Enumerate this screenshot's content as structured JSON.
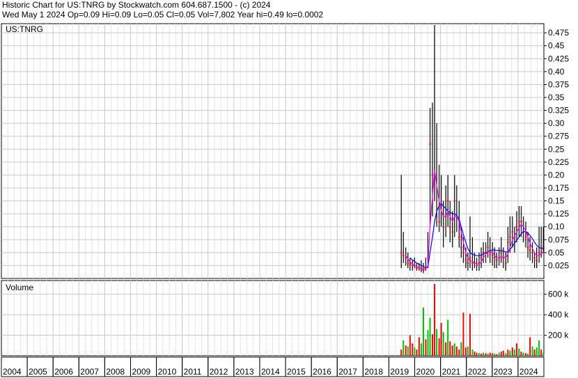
{
  "header": {
    "line1": "Historic Chart for US:TNRG by Stockwatch.com 604.687.1500 - (c) 2024",
    "line2": "Wed May  1 2024  Op=0.09  Hi=0.09  Lo=0.05  Cl=0.05  Vol=7,802  Year hi=0.49  lo=0.0002"
  },
  "colors": {
    "price_bar": "#000000",
    "ma_short": "#ff00ff",
    "ma_long": "#0000ff",
    "close_dot": "#ff0000",
    "volume_up": "#00c000",
    "volume_down": "#ff0000",
    "grid": "#c8c8c8",
    "axis": "#000000"
  },
  "chart_data": [
    {
      "type": "line",
      "panel": "price",
      "label": "US:TNRG",
      "ylim": [
        0,
        0.49
      ],
      "y_ticks": [
        "0.025",
        "0.05",
        "0.075",
        "0.10",
        "0.125",
        "0.15",
        "0.175",
        "0.20",
        "0.225",
        "0.25",
        "0.275",
        "0.30",
        "0.325",
        "0.35",
        "0.375",
        "0.40",
        "0.425",
        "0.45",
        "0.475"
      ],
      "x_ticks": [
        "2004",
        "2005",
        "2006",
        "2007",
        "2008",
        "2009",
        "2010",
        "2011",
        "2012",
        "2013",
        "2014",
        "2015",
        "2016",
        "2017",
        "2018",
        "2019",
        "2020",
        "2021",
        "2022",
        "2023",
        "2024"
      ],
      "xlim": [
        2004.0,
        2024.35
      ],
      "grid": true,
      "series": [
        {
          "x": [
            2019.0,
            2019.08,
            2019.17,
            2019.25,
            2019.33,
            2019.42,
            2019.5,
            2019.58,
            2019.67,
            2019.75,
            2019.83,
            2019.92,
            2020.0,
            2020.08,
            2020.17,
            2020.25,
            2020.33,
            2020.42,
            2020.5,
            2020.58,
            2020.67,
            2020.75,
            2020.83,
            2020.92,
            2021.0,
            2021.08,
            2021.17,
            2021.25,
            2021.33,
            2021.42,
            2021.5,
            2021.58,
            2021.67,
            2021.75,
            2021.83,
            2021.92,
            2022.0,
            2022.08,
            2022.17,
            2022.25,
            2022.33,
            2022.42,
            2022.5,
            2022.58,
            2022.67,
            2022.75,
            2022.83,
            2022.92,
            2023.0,
            2023.08,
            2023.17,
            2023.25,
            2023.33,
            2023.42,
            2023.5,
            2023.58,
            2023.67,
            2023.75,
            2023.83,
            2023.92,
            2024.0,
            2024.08,
            2024.17,
            2024.25,
            2024.33
          ],
          "high": [
            0.2,
            0.09,
            0.06,
            0.05,
            0.04,
            0.035,
            0.04,
            0.03,
            0.03,
            0.035,
            0.03,
            0.04,
            0.09,
            0.33,
            0.34,
            0.49,
            0.3,
            0.22,
            0.2,
            0.15,
            0.18,
            0.2,
            0.15,
            0.13,
            0.2,
            0.18,
            0.15,
            0.1,
            0.08,
            0.06,
            0.05,
            0.12,
            0.08,
            0.05,
            0.04,
            0.05,
            0.06,
            0.07,
            0.07,
            0.09,
            0.08,
            0.07,
            0.06,
            0.05,
            0.06,
            0.08,
            0.06,
            0.05,
            0.1,
            0.12,
            0.12,
            0.1,
            0.13,
            0.14,
            0.14,
            0.12,
            0.11,
            0.09,
            0.08,
            0.07,
            0.05,
            0.06,
            0.1,
            0.1,
            0.1
          ],
          "low": [
            0.02,
            0.03,
            0.025,
            0.02,
            0.015,
            0.015,
            0.02,
            0.015,
            0.015,
            0.012,
            0.01,
            0.015,
            0.02,
            0.1,
            0.12,
            0.15,
            0.1,
            0.09,
            0.1,
            0.06,
            0.08,
            0.1,
            0.07,
            0.06,
            0.08,
            0.09,
            0.06,
            0.04,
            0.03,
            0.02,
            0.015,
            0.02,
            0.015,
            0.02,
            0.015,
            0.015,
            0.02,
            0.03,
            0.03,
            0.04,
            0.03,
            0.025,
            0.02,
            0.02,
            0.025,
            0.03,
            0.02,
            0.015,
            0.03,
            0.05,
            0.06,
            0.05,
            0.07,
            0.08,
            0.08,
            0.07,
            0.06,
            0.04,
            0.035,
            0.03,
            0.02,
            0.02,
            0.03,
            0.04,
            0.05
          ],
          "close": [
            0.05,
            0.045,
            0.04,
            0.03,
            0.028,
            0.025,
            0.025,
            0.02,
            0.02,
            0.018,
            0.016,
            0.02,
            0.04,
            0.26,
            0.2,
            0.18,
            0.12,
            0.11,
            0.14,
            0.1,
            0.12,
            0.15,
            0.1,
            0.09,
            0.15,
            0.12,
            0.08,
            0.06,
            0.05,
            0.035,
            0.03,
            0.04,
            0.03,
            0.03,
            0.025,
            0.03,
            0.04,
            0.05,
            0.05,
            0.06,
            0.05,
            0.045,
            0.04,
            0.035,
            0.04,
            0.05,
            0.04,
            0.03,
            0.07,
            0.08,
            0.09,
            0.08,
            0.1,
            0.11,
            0.11,
            0.09,
            0.08,
            0.06,
            0.055,
            0.05,
            0.04,
            0.035,
            0.05,
            0.06,
            0.05
          ],
          "ma_short": [
            null,
            null,
            0.045,
            0.038,
            0.032,
            0.028,
            0.026,
            0.023,
            0.021,
            0.02,
            0.018,
            0.018,
            0.025,
            0.1,
            0.16,
            0.21,
            0.18,
            0.15,
            0.13,
            0.12,
            0.12,
            0.13,
            0.12,
            0.11,
            0.12,
            0.12,
            0.11,
            0.09,
            0.07,
            0.05,
            0.04,
            0.035,
            0.033,
            0.031,
            0.028,
            0.028,
            0.032,
            0.04,
            0.046,
            0.052,
            0.052,
            0.05,
            0.045,
            0.04,
            0.04,
            0.042,
            0.042,
            0.04,
            0.047,
            0.06,
            0.075,
            0.082,
            0.09,
            0.098,
            0.105,
            0.1,
            0.092,
            0.08,
            0.068,
            0.058,
            0.05,
            0.044,
            0.044,
            0.048,
            0.052
          ],
          "ma_long": [
            null,
            null,
            null,
            null,
            0.04,
            0.036,
            0.033,
            0.03,
            0.027,
            0.025,
            0.023,
            0.021,
            0.022,
            0.05,
            0.08,
            0.11,
            0.13,
            0.14,
            0.145,
            0.14,
            0.135,
            0.13,
            0.128,
            0.125,
            0.125,
            0.122,
            0.115,
            0.1,
            0.085,
            0.07,
            0.058,
            0.05,
            0.047,
            0.045,
            0.044,
            0.044,
            0.045,
            0.047,
            0.05,
            0.052,
            0.054,
            0.055,
            0.055,
            0.054,
            0.054,
            0.054,
            0.053,
            0.051,
            0.052,
            0.056,
            0.062,
            0.068,
            0.074,
            0.08,
            0.087,
            0.09,
            0.091,
            0.088,
            0.083,
            0.077,
            0.07,
            0.064,
            0.06,
            0.058,
            0.058
          ]
        }
      ]
    },
    {
      "type": "bar",
      "panel": "volume",
      "label": "Volume",
      "ylim": [
        0,
        720000
      ],
      "y_ticks": [
        "200 k",
        "400 k",
        "600 k"
      ],
      "x": [
        2019.0,
        2019.08,
        2019.17,
        2019.25,
        2019.33,
        2019.42,
        2019.5,
        2019.58,
        2019.67,
        2019.75,
        2019.83,
        2019.92,
        2020.0,
        2020.08,
        2020.17,
        2020.25,
        2020.33,
        2020.42,
        2020.5,
        2020.58,
        2020.67,
        2020.75,
        2020.83,
        2020.92,
        2021.0,
        2021.08,
        2021.17,
        2021.25,
        2021.33,
        2021.42,
        2021.5,
        2021.58,
        2021.67,
        2021.75,
        2021.83,
        2021.92,
        2022.0,
        2022.08,
        2022.17,
        2022.25,
        2022.33,
        2022.42,
        2022.5,
        2022.58,
        2022.67,
        2022.75,
        2022.83,
        2022.92,
        2023.0,
        2023.08,
        2023.17,
        2023.25,
        2023.33,
        2023.42,
        2023.5,
        2023.58,
        2023.67,
        2023.75,
        2023.83,
        2023.92,
        2024.0,
        2024.08,
        2024.17,
        2024.25,
        2024.33
      ],
      "values": [
        60000,
        150000,
        100000,
        90000,
        200000,
        120000,
        80000,
        60000,
        180000,
        120000,
        470000,
        160000,
        250000,
        370000,
        210000,
        700000,
        260000,
        170000,
        320000,
        230000,
        130000,
        350000,
        140000,
        100000,
        120000,
        90000,
        60000,
        130000,
        420000,
        80000,
        90000,
        410000,
        60000,
        40000,
        30000,
        25000,
        20000,
        30000,
        25000,
        20000,
        30000,
        25000,
        20000,
        15000,
        30000,
        40000,
        50000,
        25000,
        60000,
        50000,
        80000,
        60000,
        120000,
        70000,
        40000,
        30000,
        25000,
        20000,
        180000,
        90000,
        60000,
        80000,
        150000,
        60000,
        30000
      ],
      "up": [
        false,
        true,
        false,
        true,
        false,
        false,
        true,
        false,
        false,
        true,
        true,
        false,
        true,
        true,
        false,
        false,
        true,
        false,
        false,
        true,
        false,
        true,
        false,
        false,
        true,
        false,
        false,
        true,
        false,
        false,
        true,
        false,
        true,
        false,
        false,
        true,
        false,
        true,
        false,
        true,
        false,
        false,
        true,
        false,
        true,
        false,
        false,
        true,
        false,
        true,
        false,
        true,
        false,
        true,
        false,
        true,
        false,
        true,
        false,
        true,
        false,
        true,
        true,
        false,
        true
      ]
    }
  ]
}
